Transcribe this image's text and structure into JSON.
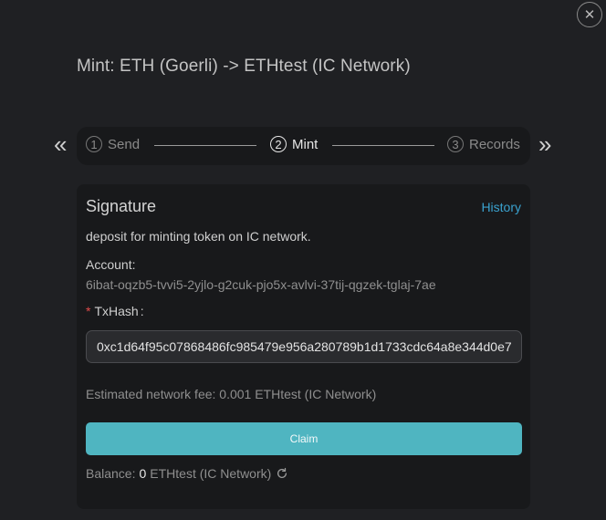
{
  "dialog": {
    "title": "Mint: ETH (Goerli) -> ETHtest (IC Network)",
    "close_icon": "close-icon"
  },
  "stepper": {
    "prev_arrow": "«",
    "next_arrow": "»",
    "steps": [
      {
        "num": "1",
        "label": "Send",
        "active": false
      },
      {
        "num": "2",
        "label": "Mint",
        "active": true
      },
      {
        "num": "3",
        "label": "Records",
        "active": false
      }
    ]
  },
  "card": {
    "title": "Signature",
    "history_link": "History",
    "description": "deposit for minting token on IC network.",
    "account_label": "Account:",
    "account_value": "6ibat-oqzb5-tvvi5-2yjlo-g2cuk-pjo5x-avlvi-37tij-qgzek-tglaj-7ae",
    "txhash_required": "*",
    "txhash_label": "TxHash",
    "txhash_colon": ":",
    "txhash_value": "0xc1d64f95c07868486fc985479e956a280789b1d1733cdc64a8e344d0e7",
    "fee_text": "Estimated network fee: 0.001 ETHtest (IC Network)",
    "claim_label": "Claim",
    "balance_label": "Balance:",
    "balance_amount": "0",
    "balance_unit": "ETHtest (IC Network)"
  },
  "colors": {
    "background": "#1f2023",
    "panel": "#18191b",
    "accent": "#4fb5c1",
    "link": "#3aa2cf",
    "required": "#e04b4b"
  }
}
